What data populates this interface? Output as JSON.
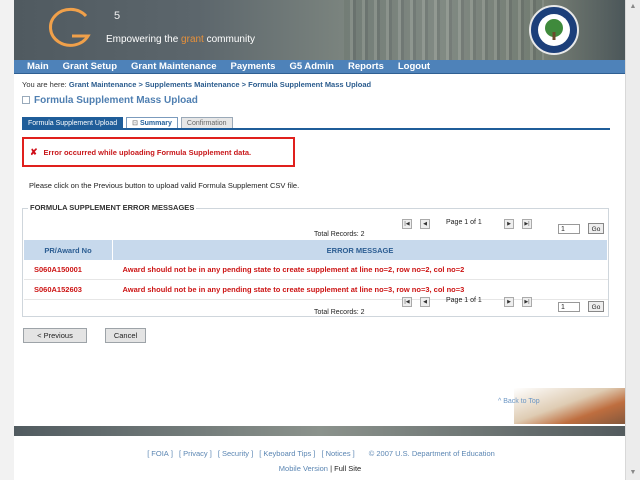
{
  "header": {
    "logo_letter": "G",
    "logo_superscript": "5",
    "tagline_pre": "Empowering the ",
    "tagline_accent": "grant",
    "tagline_post": " community"
  },
  "nav": [
    "Main",
    "Grant Setup",
    "Grant Maintenance",
    "Payments",
    "G5 Admin",
    "Reports",
    "Logout"
  ],
  "breadcrumb": {
    "prefix": "You are here:",
    "items": [
      "Grant Maintenance",
      "Supplements Maintenance",
      "Formula Supplement Mass Upload"
    ],
    "separator": ">"
  },
  "page_title": "Formula Supplement Mass Upload",
  "tabs": [
    {
      "label": "Formula Supplement Upload"
    },
    {
      "label": "Summary"
    },
    {
      "label": "Confirmation"
    }
  ],
  "error": {
    "icon": "x-icon",
    "message": "Error occurred while uploading Formula Supplement data."
  },
  "instruction": "Please click on the Previous button to upload valid Formula Supplement CSV file.",
  "section_title": "FORMULA SUPPLEMENT ERROR MESSAGES",
  "pager": {
    "total_label": "Total Records: 2",
    "page_label": "Page 1 of 1",
    "page_value": "1",
    "go_label": "Go"
  },
  "table": {
    "columns": [
      "PR/Award No",
      "ERROR MESSAGE"
    ],
    "rows": [
      {
        "award": "S060A150001",
        "message": "Award should not be in any pending state to create supplement at line no=2, row no=2, col no=2"
      },
      {
        "award": "S060A152603",
        "message": "Award should not be in any pending state to create supplement at line no=3, row no=3, col no=3"
      }
    ]
  },
  "buttons": {
    "previous": "< Previous",
    "cancel": "Cancel"
  },
  "back_to_top": "^ Back to Top",
  "footer": {
    "links": [
      "FOIA",
      "Privacy",
      "Security",
      "Keyboard Tips",
      "Notices"
    ],
    "copyright": "© 2007 U.S. Department of Education",
    "mobile": "Mobile Version",
    "divider": "|",
    "full": "Full Site"
  },
  "colors": {
    "nav_bg": "#4e82b9",
    "accent_orange": "#e8913a",
    "error_red": "#d0111b",
    "table_header_bg": "#c7d9ec",
    "active_tab": "#1f5d99"
  }
}
